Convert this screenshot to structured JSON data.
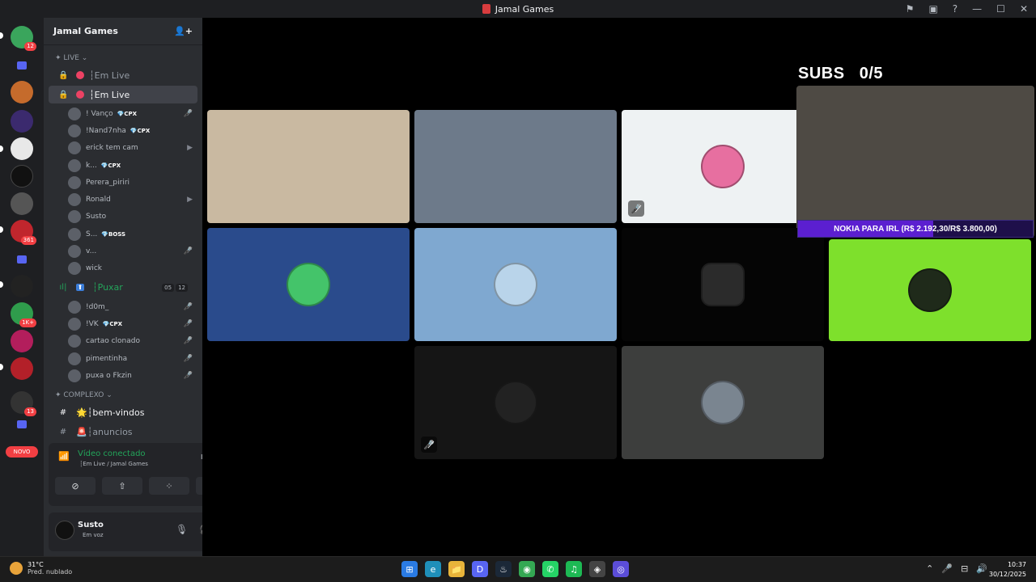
{
  "window": {
    "title": "Jamal Games",
    "controls": [
      "⚑",
      "▣",
      "?",
      "—",
      "☐",
      "✕"
    ]
  },
  "servers": {
    "badges": [
      "12",
      "361",
      "1K+",
      "13"
    ],
    "novo_label": "NOVO"
  },
  "sidebar": {
    "server_name": "Jamal Games",
    "add_member_icon": "👤+",
    "category_live": "✦ LIVE ⌄",
    "channels_top": [
      {
        "label": "┆Em Live",
        "active": false
      },
      {
        "label": "┆Em Live",
        "active": true
      }
    ],
    "members_live": [
      {
        "name": "! Vanço",
        "tag": "💎CPX",
        "status": "🎤̸"
      },
      {
        "name": "!Nand7nha",
        "tag": "💎CPX",
        "status": ""
      },
      {
        "name": "erick tem cam",
        "tag": "",
        "status": "▶"
      },
      {
        "name": "k...",
        "tag": "💎CPX",
        "status": ""
      },
      {
        "name": "Perera_piriri",
        "tag": "",
        "status": ""
      },
      {
        "name": "Ronald",
        "tag": "",
        "status": "▶"
      },
      {
        "name": "Susto",
        "tag": "",
        "status": ""
      },
      {
        "name": "S...",
        "tag": "💎BOSS",
        "status": ""
      },
      {
        "name": "v...",
        "tag": "",
        "status": "🎤̸"
      },
      {
        "name": "wick",
        "tag": "",
        "status": ""
      }
    ],
    "puxar_channel": {
      "label": "┆Puxar",
      "count_a": "05",
      "count_b": "12"
    },
    "members_puxar": [
      {
        "name": "!d0m_",
        "tag": "",
        "status": "🎤̸"
      },
      {
        "name": "!VK",
        "tag": "💎CPX",
        "status": "🎤̸"
      },
      {
        "name": "cartao clonado",
        "tag": "",
        "status": "🎤̸"
      },
      {
        "name": "pimentinha",
        "tag": "",
        "status": "🎤̸"
      },
      {
        "name": "puxa o Fkzin",
        "tag": "",
        "status": "🎤̸"
      }
    ],
    "category_complexo": "✦ COMPLEXO ⌄",
    "channels_bottom": [
      {
        "label": "🌟┆bem-vindos",
        "active": false
      },
      {
        "label": "🚨┆anuncios",
        "active": false
      }
    ]
  },
  "voice_panel": {
    "title": "Vídeo conectado",
    "subtitle": "┆Em Live / Jamal Games"
  },
  "user_panel": {
    "name": "Susto",
    "status": "Em voz"
  },
  "overlay": {
    "subs_label": "SUBS",
    "subs_value": "0/5",
    "goal_text": "NOKIA PARA IRL (R$ 2.192,30/R$ 3.800,00)",
    "goal_progress": 0.577
  },
  "tiles": [
    {
      "name": "tile-cam-1",
      "kind": "camera",
      "bg": "#c9b9a1"
    },
    {
      "name": "tile-cam-2",
      "kind": "camera",
      "bg": "#6d7a8a"
    },
    {
      "name": "tile-avatar-3",
      "kind": "avatar",
      "bg": "#eef2f3"
    },
    {
      "name": "tile-cam-4",
      "kind": "camera",
      "bg": "#4e4a44"
    },
    {
      "name": "tile-avatar-5",
      "kind": "avatar",
      "bg": "#2a4b8c"
    },
    {
      "name": "tile-avatar-6",
      "kind": "avatar",
      "bg": "#7fa8d0"
    },
    {
      "name": "tile-avatar-7",
      "kind": "avatar",
      "bg": "#050505"
    },
    {
      "name": "tile-avatar-8",
      "kind": "avatar",
      "bg": "#7ee02c"
    },
    {
      "name": "tile-avatar-9",
      "kind": "avatar",
      "bg": "#151515"
    },
    {
      "name": "tile-avatar-10",
      "kind": "avatar",
      "bg": "#3d3e3d"
    }
  ],
  "taskbar": {
    "weather_temp": "31°C",
    "weather_desc": "Pred. nublado",
    "time": "10:37",
    "date": "30/12/2025",
    "apps": [
      "⊞",
      "e",
      "📁",
      "D",
      "♨",
      "◉",
      "✆",
      "♫",
      "◈",
      "◎"
    ]
  }
}
